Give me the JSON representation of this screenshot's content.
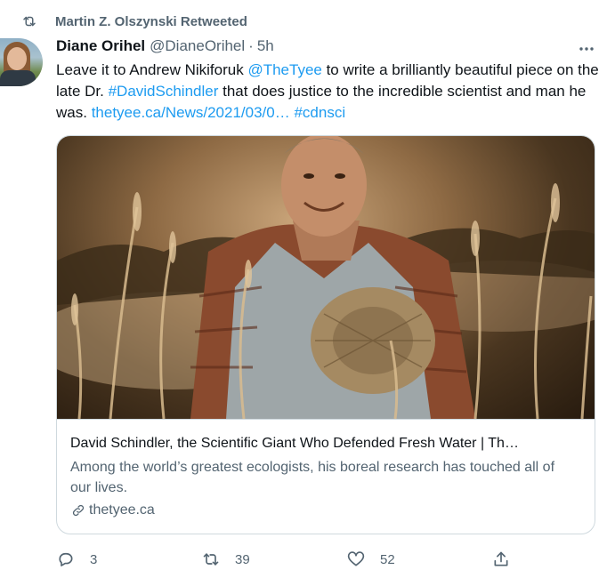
{
  "retweet": {
    "label": "Martin Z. Olszynski Retweeted",
    "icon": "retweet-icon"
  },
  "author": {
    "name": "Diane Orihel",
    "handle": "@DianeOrihel",
    "separator": "·",
    "time": "5h",
    "avatar": "avatar"
  },
  "tweet": {
    "text_1": "Leave it to Andrew Nikiforuk ",
    "mention": "@TheTyee",
    "text_2": " to write a brilliantly beautiful piece on the late Dr. ",
    "hashtag_1": "#DavidSchindler",
    "text_3": " that does justice to the incredible scientist and man he was.  ",
    "url": "thetyee.ca/News/2021/03/0…",
    "text_4": " ",
    "hashtag_2": "#cdnsci"
  },
  "card": {
    "title": "David Schindler, the Scientific Giant Who Defended Fresh Water | Th…",
    "description": "Among the world’s greatest ecologists, his boreal research has touched all of our lives.",
    "domain": "thetyee.ca",
    "image": "portrait-photo"
  },
  "actions": {
    "reply_count": "3",
    "retweet_count": "39",
    "like_count": "52"
  },
  "colors": {
    "link": "#1d9bf0",
    "secondary_text": "#536471",
    "primary_text": "#0f1419",
    "border": "#cfd9de"
  }
}
